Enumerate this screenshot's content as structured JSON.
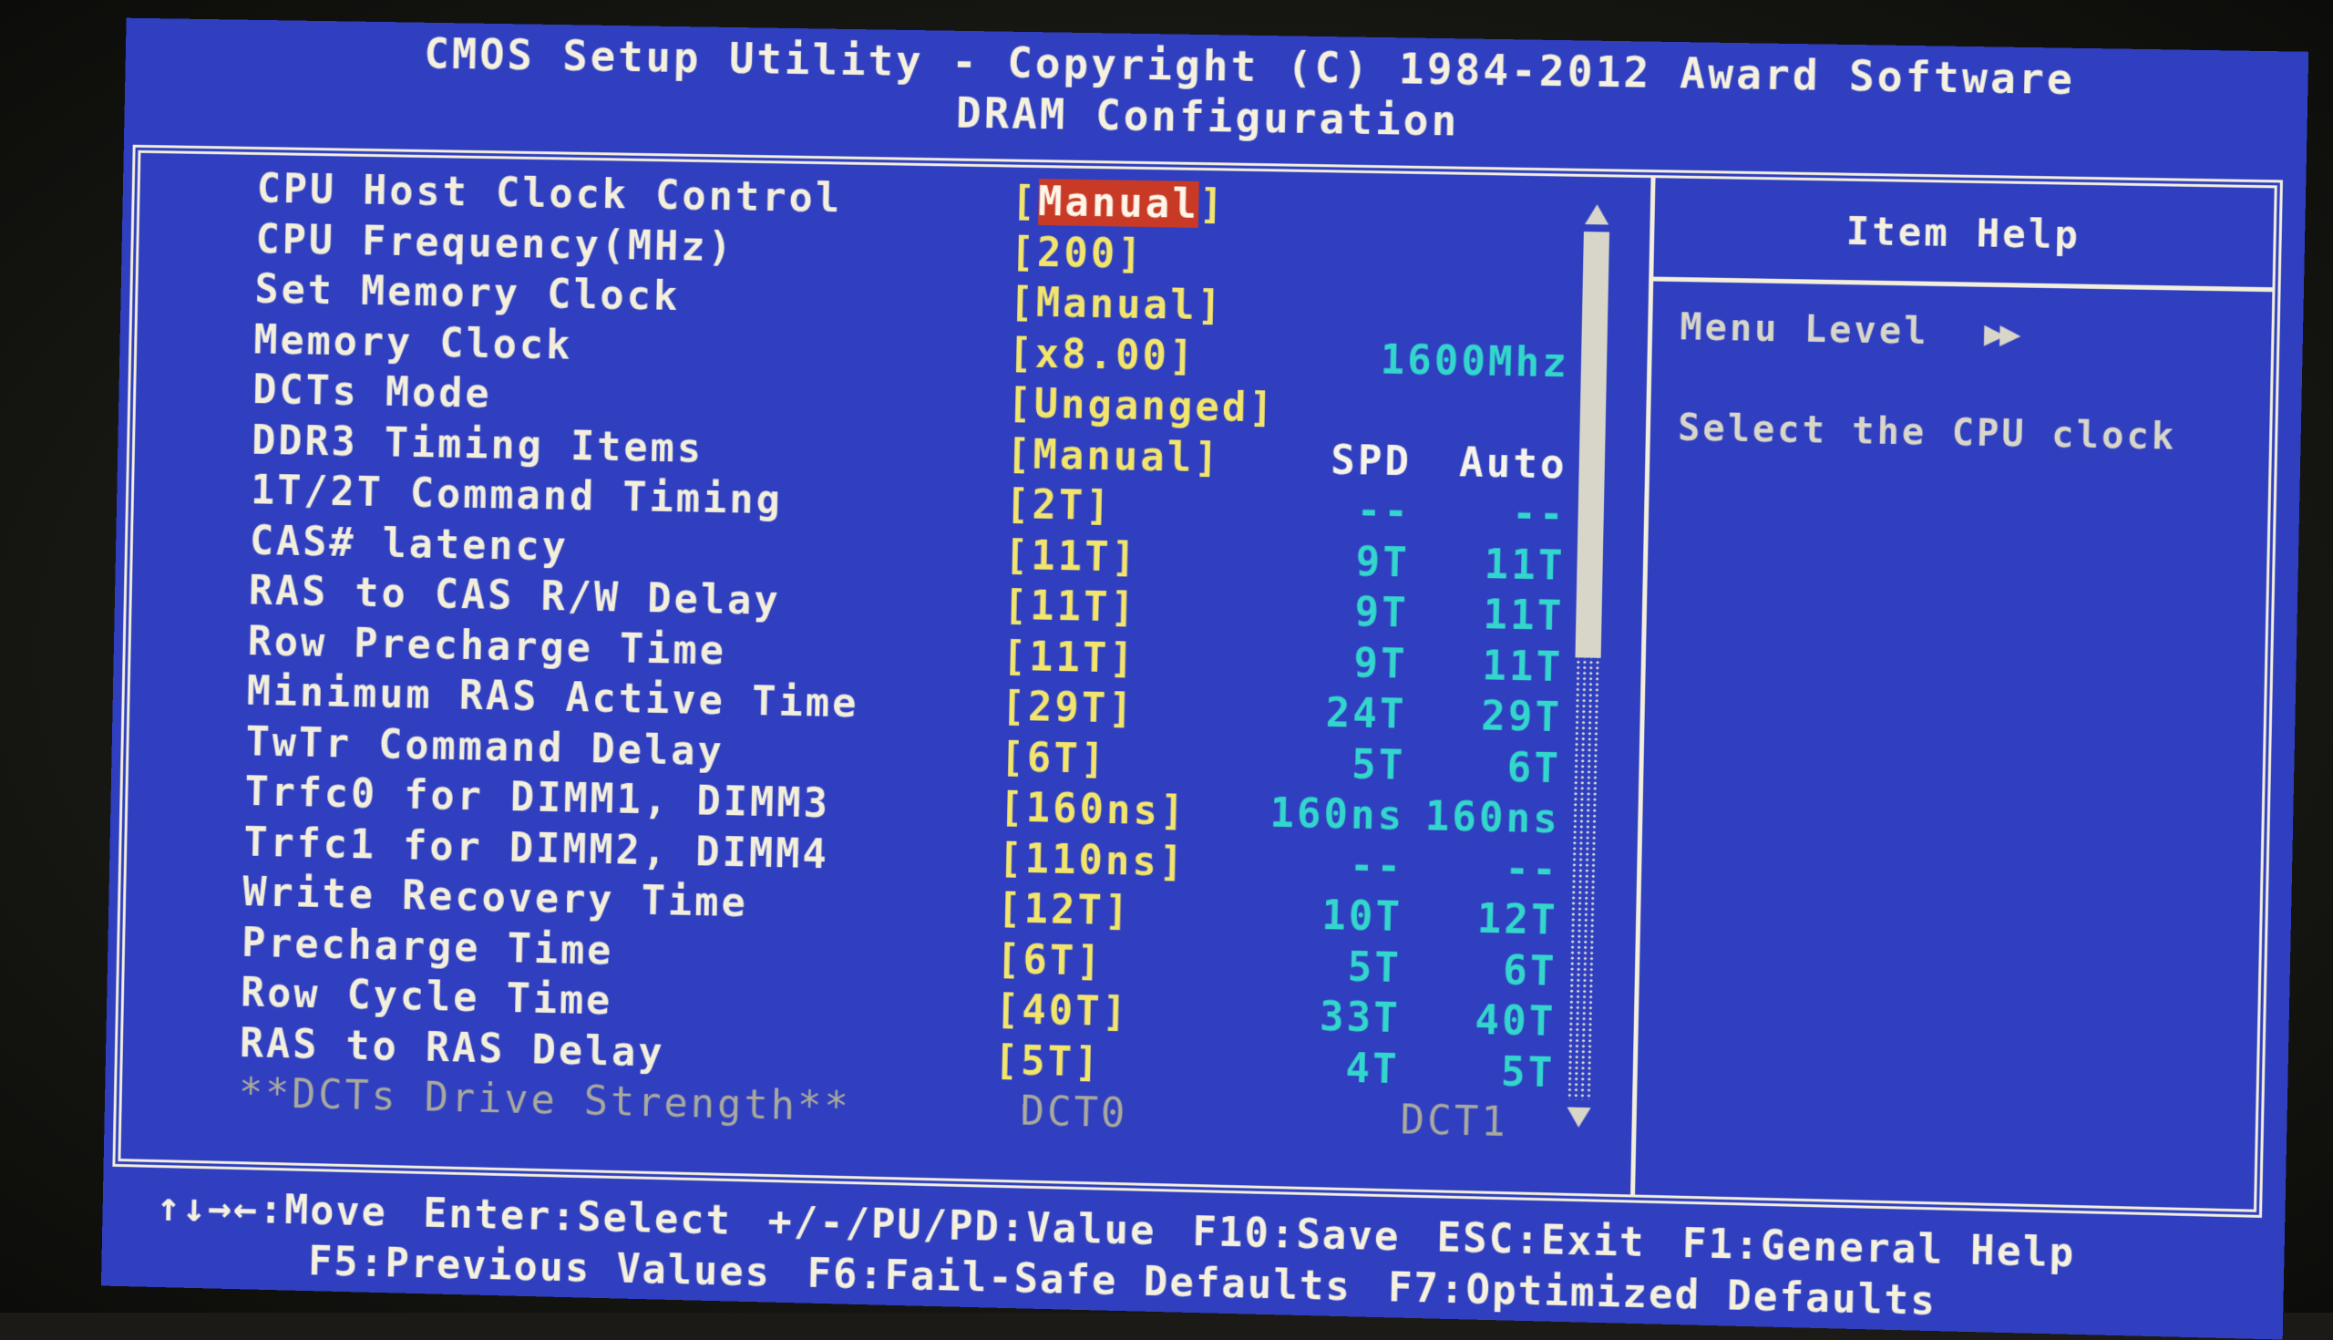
{
  "header": {
    "title": "CMOS Setup Utility - Copyright (C) 1984-2012 Award Software",
    "subtitle": "DRAM Configuration"
  },
  "items": [
    {
      "label": "CPU Host Clock Control",
      "value": "[Manual]",
      "selected": true
    },
    {
      "label": "CPU Frequency(MHz)",
      "value": "[200]"
    },
    {
      "label": "Set Memory Clock",
      "value": "[Manual]"
    },
    {
      "label": "Memory Clock",
      "value": "[x8.00]",
      "info": "1600Mhz"
    },
    {
      "label": "DCTs Mode",
      "value": "[Unganged]"
    },
    {
      "label": "DDR3 Timing Items",
      "value": "[Manual]",
      "spd": "SPD",
      "auto": "Auto"
    },
    {
      "label": "1T/2T Command Timing",
      "value": "[2T]",
      "spd": "--",
      "auto": "--"
    },
    {
      "label": "CAS# latency",
      "value": "[11T]",
      "spd": "9T",
      "auto": "11T"
    },
    {
      "label": "RAS to CAS R/W Delay",
      "value": "[11T]",
      "spd": "9T",
      "auto": "11T"
    },
    {
      "label": "Row Precharge Time",
      "value": "[11T]",
      "spd": "9T",
      "auto": "11T"
    },
    {
      "label": "Minimum RAS Active Time",
      "value": "[29T]",
      "spd": "24T",
      "auto": "29T"
    },
    {
      "label": "TwTr Command Delay",
      "value": "[6T]",
      "spd": "5T",
      "auto": "6T"
    },
    {
      "label": "Trfc0 for DIMM1, DIMM3",
      "value": "[160ns]",
      "spd": "160ns",
      "auto": "160ns"
    },
    {
      "label": "Trfc1 for DIMM2, DIMM4",
      "value": "[110ns]",
      "spd": "--",
      "auto": "--"
    },
    {
      "label": "Write Recovery Time",
      "value": "[12T]",
      "spd": "10T",
      "auto": "12T"
    },
    {
      "label": "Precharge Time",
      "value": "[6T]",
      "spd": "5T",
      "auto": "6T"
    },
    {
      "label": "Row Cycle Time",
      "value": "[40T]",
      "spd": "33T",
      "auto": "40T"
    },
    {
      "label": "RAS to RAS Delay",
      "value": "[5T]",
      "spd": "4T",
      "auto": "5T"
    }
  ],
  "section": {
    "label": "**DCTs Drive Strength**",
    "dct0": "DCT0",
    "dct1": "DCT1"
  },
  "scrollbar": {
    "visible_fraction": 0.49,
    "position": 0.0
  },
  "help": {
    "title": "Item Help",
    "menu_level_label": "Menu Level",
    "menu_level_icon": "double-right-arrow",
    "menu_level_glyph": "▶▶",
    "text": "Select the CPU clock"
  },
  "footer": {
    "row1": [
      "↑↓→←:Move",
      "Enter:Select",
      "+/-/PU/PD:Value",
      "F10:Save",
      "ESC:Exit",
      "F1:General Help"
    ],
    "row2": [
      "F5:Previous Values",
      "F6:Fail-Safe Defaults",
      "F7:Optimized Defaults"
    ]
  },
  "colors": {
    "background": "#2f3fbf",
    "text": "#f3efdc",
    "value": "#f3e56c",
    "info": "#33d6cc",
    "highlight": "#c83a26",
    "disabled": "#a9a99d"
  }
}
